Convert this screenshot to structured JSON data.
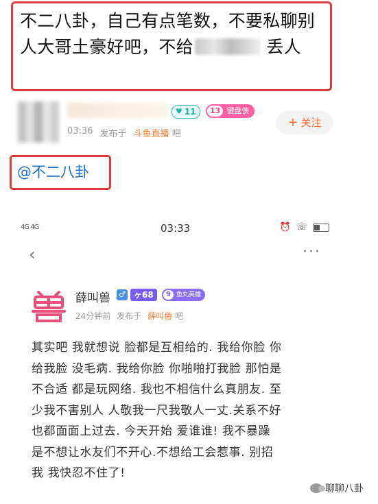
{
  "top_post": {
    "text_before_blur": "不二八卦，自己有点笔数，不要私聊别人大哥土豪好吧，不给",
    "text_after_blur": "丢人",
    "author": {
      "level": "11",
      "fan_badge_level": "13",
      "fan_badge_name": "键盘侠",
      "time": "03:36",
      "published_in_label": "发布于",
      "source": "斗鱼直播",
      "source_suffix": "吧"
    },
    "follow_label": "关注",
    "follow_icon": "plus-icon",
    "mention": "@不二八卦"
  },
  "embedded_screen": {
    "status_bar": {
      "signal": "4G 4G",
      "time": "03:33",
      "icons": [
        "alarm-icon",
        "hd-call-icon",
        "battery-icon"
      ]
    },
    "nav": {
      "back_icon": "chevron-left-icon",
      "more_icon": "ellipsis-icon"
    },
    "post": {
      "author_name": "薛叫兽",
      "gender_symbol": "♂",
      "level": "68",
      "fan_badge_level": "9",
      "fan_badge_name": "鱼丸英雄",
      "time_ago": "24分钟前",
      "published_in_label": "发布于",
      "source": "薛叫兽",
      "source_suffix": "吧",
      "body_lines": [
        "其实吧 我就想说 脸都是互相给的. 我给你脸 你",
        "给我脸 没毛病. 我给你脸 你啪啪打我脸 那怕是",
        "不合适 都是玩网络. 我也不相信什么真朋友. 至",
        "少我不害别人 人敬我一尺我敬人一丈.关系不好",
        "也都面面上过去. 今天开始 爱谁谁! 我不暴躁",
        "是不想让水友们不开心.不想给工会惹事. 别招",
        "我 我快忍不住了!"
      ]
    }
  },
  "watermark": {
    "text": "聊聊八卦",
    "icon": "wechat-icon"
  },
  "colors": {
    "highlight_border": "#e23b3b",
    "mention_blue": "#1f6fd1",
    "source_orange": "#ff7a33",
    "follow_orange": "#ff6a2a",
    "fan_pink": "#ff5fa2",
    "level_purple": "#7b5cf0",
    "logo_pink": "#e8507a"
  }
}
